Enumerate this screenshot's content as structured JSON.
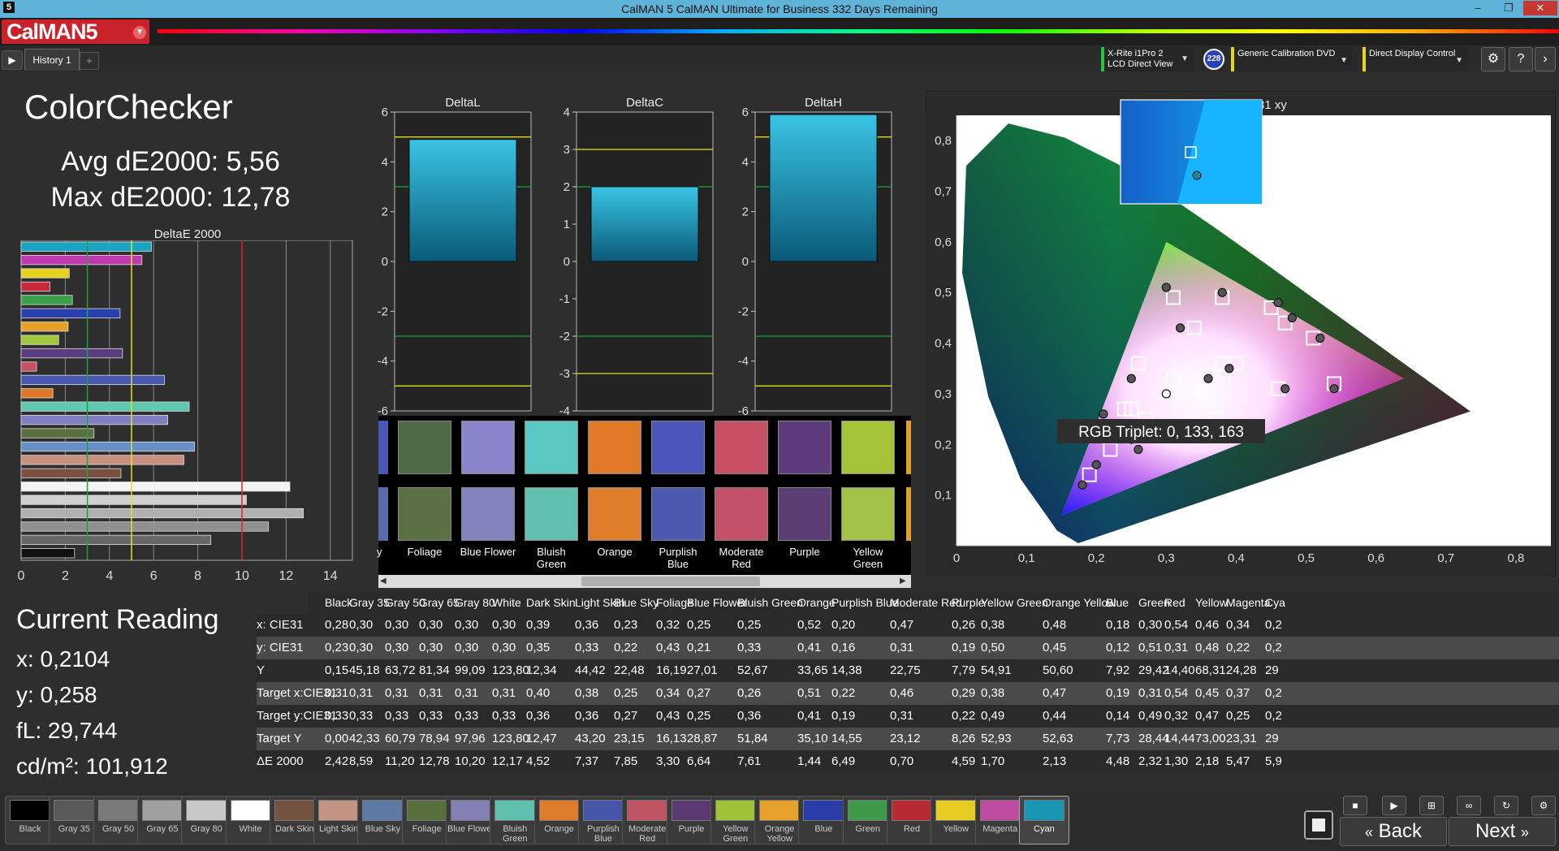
{
  "window": {
    "title": "CalMAN 5 CalMAN Ultimate for Business 332 Days Remaining",
    "app_icon": "5"
  },
  "header": {
    "logo": "CalMAN5"
  },
  "toolbar": {
    "tab": "History 1",
    "meter": {
      "line1": "X-Rite i1Pro 2",
      "line2": "LCD Direct View"
    },
    "meter_badge": "228",
    "source": {
      "line1": "Generic Calibration DVD"
    },
    "display": {
      "line1": "Direct Display Control"
    }
  },
  "summary": {
    "title": "ColorChecker",
    "avg": "Avg dE2000: 5,56",
    "max": "Max dE2000: 12,78",
    "chart_title": "DeltaE 2000"
  },
  "current_reading": {
    "title": "Current Reading",
    "x": "x: 0,2104",
    "y": "y: 0,258",
    "fl": "fL: 29,744",
    "cd": "cd/m²: 101,912"
  },
  "cie": {
    "title": "CIE 1931 xy",
    "rgb_triplet": "RGB Triplet: 0, 133, 163"
  },
  "chart_data": [
    {
      "type": "bar",
      "title": "DeltaE 2000",
      "orientation": "horizontal",
      "categories": [
        "Cyan",
        "Magenta",
        "Yellow",
        "Red",
        "Green",
        "Blue",
        "Orange Yellow",
        "Yellow Green",
        "Purple",
        "Moderate Red",
        "Purplish Blue",
        "Orange",
        "Bluish Green",
        "Blue Flower",
        "Foliage",
        "Blue Sky",
        "Light Skin",
        "Dark Skin",
        "White",
        "Gray 80",
        "Gray 65",
        "Gray 50",
        "Gray 35",
        "Black"
      ],
      "values": [
        5.9,
        5.47,
        2.18,
        1.3,
        2.32,
        4.48,
        2.13,
        1.7,
        4.59,
        0.7,
        6.49,
        1.44,
        7.61,
        6.64,
        3.3,
        7.85,
        7.37,
        4.52,
        12.17,
        10.2,
        12.78,
        11.2,
        8.59,
        2.42
      ],
      "colors": [
        "#1aa4c4",
        "#c23ab0",
        "#e6d21e",
        "#c8283a",
        "#3aa04a",
        "#2a40b0",
        "#e8a028",
        "#a0c83c",
        "#5a3c80",
        "#c85064",
        "#4858b0",
        "#e07828",
        "#5ec8b0",
        "#8080c0",
        "#5a7040",
        "#6890c8",
        "#c89080",
        "#7a5040",
        "#f4f4f4",
        "#d0d0d0",
        "#b0b0b0",
        "#909090",
        "#686868",
        "#101010"
      ],
      "xlim": [
        0,
        15
      ],
      "xticks": [
        "0",
        "2",
        "4",
        "6",
        "8",
        "10",
        "12",
        "14"
      ],
      "thresholds": [
        {
          "value": 3,
          "color": "#20a040"
        },
        {
          "value": 5,
          "color": "#e0e020"
        },
        {
          "value": 10,
          "color": "#e02020"
        }
      ],
      "grid": true
    },
    {
      "type": "bar",
      "title": "DeltaL",
      "values": [
        4.9
      ],
      "ylim": [
        -6,
        6
      ],
      "yticks": [
        "6",
        "4",
        "2",
        "0",
        "-2",
        "-4",
        "-6"
      ],
      "lines": [
        5,
        3,
        -3,
        -5
      ]
    },
    {
      "type": "bar",
      "title": "DeltaC",
      "values": [
        2.0
      ],
      "ylim": [
        -4,
        4
      ],
      "yticks": [
        "4",
        "3",
        "2",
        "1",
        "0",
        "-1",
        "-2",
        "-3",
        "-4"
      ],
      "lines": [
        3,
        2,
        -2,
        -3
      ]
    },
    {
      "type": "bar",
      "title": "DeltaH",
      "values": [
        5.9
      ],
      "ylim": [
        -6,
        6
      ],
      "yticks": [
        "6",
        "4",
        "2",
        "0",
        "-2",
        "-4",
        "-6"
      ],
      "lines": [
        5,
        3,
        -3,
        -5
      ]
    },
    {
      "type": "scatter",
      "title": "CIE 1931 xy",
      "xlim": [
        0,
        0.85
      ],
      "ylim": [
        0,
        0.85
      ],
      "xticks": [
        "0",
        "0,1",
        "0,2",
        "0,3",
        "0,4",
        "0,5",
        "0,6",
        "0,7",
        "0,8"
      ],
      "yticks": [
        "0",
        "0,1",
        "0,2",
        "0,3",
        "0,4",
        "0,5",
        "0,6",
        "0,7",
        "0,8"
      ],
      "gamut": [
        [
          0.64,
          0.33
        ],
        [
          0.3,
          0.6
        ],
        [
          0.15,
          0.06
        ]
      ],
      "targets": [
        [
          0.31,
          0.33
        ],
        [
          0.4,
          0.36
        ],
        [
          0.38,
          0.36
        ],
        [
          0.25,
          0.27
        ],
        [
          0.34,
          0.43
        ],
        [
          0.27,
          0.25
        ],
        [
          0.26,
          0.36
        ],
        [
          0.51,
          0.41
        ],
        [
          0.22,
          0.19
        ],
        [
          0.46,
          0.31
        ],
        [
          0.29,
          0.22
        ],
        [
          0.38,
          0.49
        ],
        [
          0.47,
          0.44
        ],
        [
          0.19,
          0.14
        ],
        [
          0.31,
          0.49
        ],
        [
          0.54,
          0.32
        ],
        [
          0.45,
          0.47
        ],
        [
          0.37,
          0.25
        ],
        [
          0.24,
          0.27
        ]
      ],
      "measured": [
        [
          0.3,
          0.3
        ],
        [
          0.39,
          0.35
        ],
        [
          0.36,
          0.33
        ],
        [
          0.23,
          0.22
        ],
        [
          0.32,
          0.43
        ],
        [
          0.25,
          0.21
        ],
        [
          0.25,
          0.33
        ],
        [
          0.52,
          0.41
        ],
        [
          0.2,
          0.16
        ],
        [
          0.47,
          0.31
        ],
        [
          0.26,
          0.19
        ],
        [
          0.38,
          0.5
        ],
        [
          0.48,
          0.45
        ],
        [
          0.18,
          0.12
        ],
        [
          0.3,
          0.51
        ],
        [
          0.54,
          0.31
        ],
        [
          0.46,
          0.48
        ],
        [
          0.34,
          0.22
        ],
        [
          0.21,
          0.26
        ],
        [
          0.28,
          0.23
        ]
      ],
      "inset_target": [
        0.3,
        0.3
      ],
      "inset_measured": [
        0.2104,
        0.258
      ]
    }
  ],
  "swatches_top": [
    {
      "color": "#4f6b45"
    },
    {
      "color": "#8a84cb"
    },
    {
      "color": "#5bc9c1"
    },
    {
      "color": "#e07a28"
    },
    {
      "color": "#4b56bb"
    },
    {
      "color": "#c75063"
    },
    {
      "color": "#5c3a7c"
    },
    {
      "color": "#a5c438"
    }
  ],
  "swatches_bottom": [
    {
      "color": "#5c7045",
      "label": "Foliage"
    },
    {
      "color": "#8383be",
      "label": "Blue Flower"
    },
    {
      "color": "#62c0ae",
      "label": "Bluish Green"
    },
    {
      "color": "#e07d2b",
      "label": "Orange"
    },
    {
      "color": "#4b5aae",
      "label": "Purplish Blue"
    },
    {
      "color": "#c3516a",
      "label": "Moderate Red"
    },
    {
      "color": "#5c3d74",
      "label": "Purple"
    },
    {
      "color": "#a2c247",
      "label": "Yellow Green"
    }
  ],
  "strip_partial_label": "y",
  "table": {
    "columns": [
      "Black",
      "Gray 35",
      "Gray 50",
      "Gray 65",
      "Gray 80",
      "White",
      "Dark Skin",
      "Light Skin",
      "Blue Sky",
      "Foliage",
      "Blue Flower",
      "Bluish Green",
      "Orange",
      "Purplish Blue",
      "Moderate Red",
      "Purple",
      "Yellow Green",
      "Orange Yellow",
      "Blue",
      "Green",
      "Red",
      "Yellow",
      "Magenta",
      "Cya"
    ],
    "rows": [
      {
        "label": "x: CIE31",
        "cells": [
          "0,28",
          "0,30",
          "0,30",
          "0,30",
          "0,30",
          "0,30",
          "0,39",
          "0,36",
          "0,23",
          "0,32",
          "0,25",
          "0,25",
          "0,52",
          "0,20",
          "0,47",
          "0,26",
          "0,38",
          "0,48",
          "0,18",
          "0,30",
          "0,54",
          "0,46",
          "0,34",
          "0,2"
        ]
      },
      {
        "label": "y: CIE31",
        "cells": [
          "0,23",
          "0,30",
          "0,30",
          "0,30",
          "0,30",
          "0,30",
          "0,35",
          "0,33",
          "0,22",
          "0,43",
          "0,21",
          "0,33",
          "0,41",
          "0,16",
          "0,31",
          "0,19",
          "0,50",
          "0,45",
          "0,12",
          "0,51",
          "0,31",
          "0,48",
          "0,22",
          "0,2"
        ]
      },
      {
        "label": "Y",
        "cells": [
          "0,15",
          "45,18",
          "63,72",
          "81,34",
          "99,09",
          "123,80",
          "12,34",
          "44,42",
          "22,48",
          "16,19",
          "27,01",
          "52,67",
          "33,65",
          "14,38",
          "22,75",
          "7,79",
          "54,91",
          "50,60",
          "7,92",
          "29,42",
          "14,40",
          "68,31",
          "24,28",
          "29"
        ]
      },
      {
        "label": "Target x:CIE31",
        "cells": [
          "0,31",
          "0,31",
          "0,31",
          "0,31",
          "0,31",
          "0,31",
          "0,40",
          "0,38",
          "0,25",
          "0,34",
          "0,27",
          "0,26",
          "0,51",
          "0,22",
          "0,46",
          "0,29",
          "0,38",
          "0,47",
          "0,19",
          "0,31",
          "0,54",
          "0,45",
          "0,37",
          "0,2"
        ]
      },
      {
        "label": "Target y:CIE31",
        "cells": [
          "0,33",
          "0,33",
          "0,33",
          "0,33",
          "0,33",
          "0,33",
          "0,36",
          "0,36",
          "0,27",
          "0,43",
          "0,25",
          "0,36",
          "0,41",
          "0,19",
          "0,31",
          "0,22",
          "0,49",
          "0,44",
          "0,14",
          "0,49",
          "0,32",
          "0,47",
          "0,25",
          "0,2"
        ]
      },
      {
        "label": "Target Y",
        "cells": [
          "0,00",
          "42,33",
          "60,79",
          "78,94",
          "97,96",
          "123,80",
          "12,47",
          "43,20",
          "23,15",
          "16,13",
          "28,87",
          "51,84",
          "35,10",
          "14,55",
          "23,12",
          "8,26",
          "52,93",
          "52,63",
          "7,73",
          "28,44",
          "14,44",
          "73,00",
          "23,31",
          "29"
        ]
      },
      {
        "label": "ΔE 2000",
        "cells": [
          "2,42",
          "8,59",
          "11,20",
          "12,78",
          "10,20",
          "12,17",
          "4,52",
          "7,37",
          "7,85",
          "3,30",
          "6,64",
          "7,61",
          "1,44",
          "6,49",
          "0,70",
          "4,59",
          "1,70",
          "2,13",
          "4,48",
          "2,32",
          "1,30",
          "2,18",
          "5,47",
          "5,9"
        ]
      }
    ]
  },
  "bottom_swatches": [
    {
      "label": "Black",
      "color": "#000000"
    },
    {
      "label": "Gray 35",
      "color": "#595959"
    },
    {
      "label": "Gray 50",
      "color": "#7a7a7a"
    },
    {
      "label": "Gray 65",
      "color": "#a0a0a0"
    },
    {
      "label": "Gray 80",
      "color": "#c8c8c8"
    },
    {
      "label": "White",
      "color": "#ffffff"
    },
    {
      "label": "Dark Skin",
      "color": "#73523f"
    },
    {
      "label": "Light Skin",
      "color": "#c49483"
    },
    {
      "label": "Blue Sky",
      "color": "#5c7aa4"
    },
    {
      "label": "Foliage",
      "color": "#58703e"
    },
    {
      "label": "Blue Flower",
      "color": "#8280b4"
    },
    {
      "label": "Bluish Green",
      "color": "#60c0ae"
    },
    {
      "label": "Orange",
      "color": "#df7c2c"
    },
    {
      "label": "Purplish Blue",
      "color": "#4656a8"
    },
    {
      "label": "Moderate Red",
      "color": "#c15462"
    },
    {
      "label": "Purple",
      "color": "#5a3a70"
    },
    {
      "label": "Yellow Green",
      "color": "#9ec238"
    },
    {
      "label": "Orange Yellow",
      "color": "#e6a22c"
    },
    {
      "label": "Blue",
      "color": "#2a3ca8"
    },
    {
      "label": "Green",
      "color": "#3e9a48"
    },
    {
      "label": "Red",
      "color": "#b82a34"
    },
    {
      "label": "Yellow",
      "color": "#e8cc22"
    },
    {
      "label": "Magenta",
      "color": "#be4ca0"
    },
    {
      "label": "Cyan",
      "color": "#1896b4"
    }
  ],
  "nav": {
    "back": "Back",
    "next": "Next"
  }
}
